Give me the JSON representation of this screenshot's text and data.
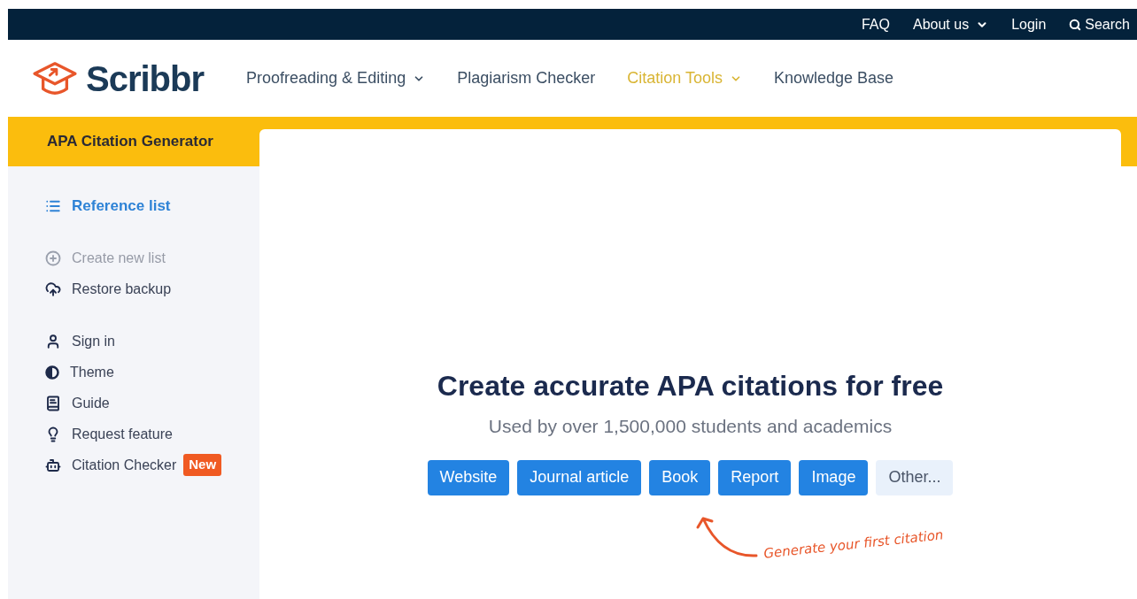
{
  "top_bar": {
    "links": [
      {
        "label": "FAQ",
        "dropdown": false,
        "kind": "link"
      },
      {
        "label": "About us",
        "dropdown": true,
        "kind": "link"
      },
      {
        "label": "Login",
        "dropdown": false,
        "kind": "link"
      },
      {
        "label": "Search",
        "dropdown": false,
        "kind": "search"
      }
    ]
  },
  "header": {
    "logo": "Scribbr",
    "nav": [
      {
        "label": "Proofreading & Editing",
        "dropdown": true,
        "selected": false
      },
      {
        "label": "Plagiarism Checker",
        "dropdown": false,
        "selected": false
      },
      {
        "label": "Citation Tools",
        "dropdown": true,
        "selected": true
      },
      {
        "label": "Knowledge Base",
        "dropdown": false,
        "selected": false
      }
    ]
  },
  "sidebar": {
    "title": "APA Citation Generator",
    "groups": [
      [
        {
          "label": "Reference list",
          "selected": true,
          "disabled": false
        }
      ],
      [
        {
          "label": "Create new list",
          "selected": false,
          "disabled": true
        },
        {
          "label": "Restore backup",
          "selected": false,
          "disabled": false
        }
      ],
      [
        {
          "label": "Sign in",
          "selected": false,
          "disabled": false
        },
        {
          "label": "Theme",
          "selected": false,
          "disabled": false
        },
        {
          "label": "Guide",
          "selected": false,
          "disabled": false
        },
        {
          "label": "Request feature",
          "selected": false,
          "disabled": false
        },
        {
          "label": "Citation Checker",
          "selected": false,
          "disabled": false,
          "badge": "New"
        }
      ]
    ]
  },
  "main": {
    "heading": "Create accurate APA citations for free",
    "subheading": "Used by over 1,500,000 students and academics",
    "source_buttons": [
      {
        "label": "Website",
        "kind": "primary"
      },
      {
        "label": "Journal article",
        "kind": "primary"
      },
      {
        "label": "Book",
        "kind": "primary"
      },
      {
        "label": "Report",
        "kind": "primary"
      },
      {
        "label": "Image",
        "kind": "primary"
      },
      {
        "label": "Other...",
        "kind": "secondary"
      }
    ],
    "hint": "Generate your first citation"
  }
}
